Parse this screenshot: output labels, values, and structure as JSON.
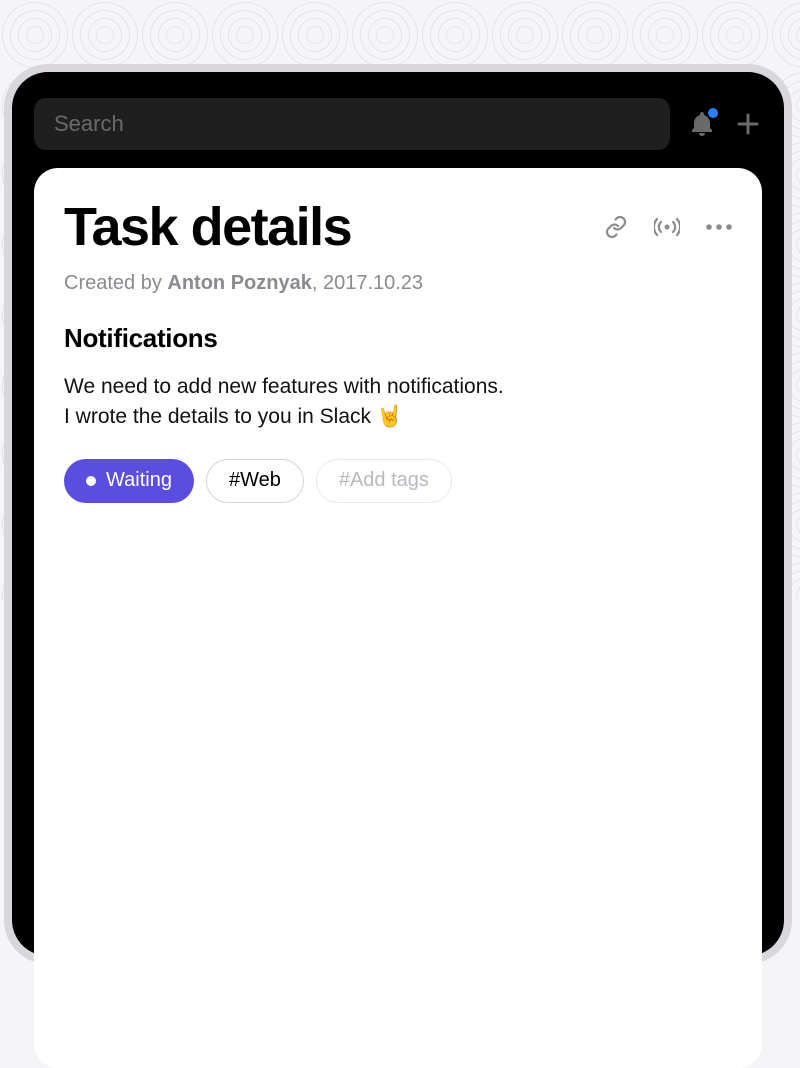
{
  "topbar": {
    "search_placeholder": "Search"
  },
  "card": {
    "title": "Task details",
    "meta_prefix": "Created by ",
    "author": "Anton Poznyak",
    "meta_date": ", 2017.10.23",
    "section_title": "Notifications",
    "body_line1": "We need to add new features with notifications.",
    "body_line2": "I wrote the details to you in Slack 🤘"
  },
  "tags": {
    "status": "Waiting",
    "web": "#Web",
    "add": "#Add tags"
  },
  "colors": {
    "accent": "#5b4de0",
    "notification_dot": "#2a7fff"
  }
}
